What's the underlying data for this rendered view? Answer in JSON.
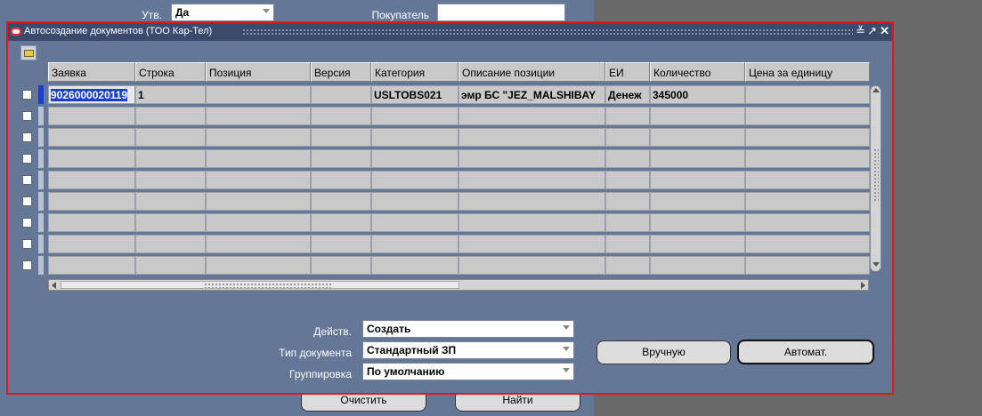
{
  "background_form": {
    "approved_label": "Утв.",
    "approved_value": "Да",
    "buyer_label": "Покупатель",
    "buyer_value": "",
    "clear_button": "Очистить",
    "find_button": "Найти"
  },
  "dialog": {
    "title": "Автосоздание документов (ТОО Кар-Тел)",
    "columns": [
      "Заявка",
      "Строка",
      "Позиция",
      "Версия",
      "Категория",
      "Описание позиции",
      "ЕИ",
      "Количество",
      "Цена за единицу"
    ],
    "rows": [
      [
        "9026000020119",
        "1",
        "",
        "",
        "USLTOBS021",
        "эмр БС \"JEZ_MALSHIBAY",
        "Денеж",
        "345000",
        ""
      ],
      [
        "",
        "",
        "",
        "",
        "",
        "",
        "",
        "",
        ""
      ],
      [
        "",
        "",
        "",
        "",
        "",
        "",
        "",
        "",
        ""
      ],
      [
        "",
        "",
        "",
        "",
        "",
        "",
        "",
        "",
        ""
      ],
      [
        "",
        "",
        "",
        "",
        "",
        "",
        "",
        "",
        ""
      ],
      [
        "",
        "",
        "",
        "",
        "",
        "",
        "",
        "",
        ""
      ],
      [
        "",
        "",
        "",
        "",
        "",
        "",
        "",
        "",
        ""
      ],
      [
        "",
        "",
        "",
        "",
        "",
        "",
        "",
        "",
        ""
      ],
      [
        "",
        "",
        "",
        "",
        "",
        "",
        "",
        "",
        ""
      ]
    ],
    "action_label": "Действ.",
    "action_value": "Создать",
    "doctype_label": "Тип документа",
    "doctype_value": "Стандартный ЗП",
    "grouping_label": "Группировка",
    "grouping_value": "По умолчанию",
    "manual_button": "Вручную",
    "auto_button": "Автомат."
  },
  "colors": {
    "panel": "#647797",
    "titlebar": "#3b4b6d",
    "dialog_border": "#e01818",
    "selection": "#1a3fcf"
  }
}
